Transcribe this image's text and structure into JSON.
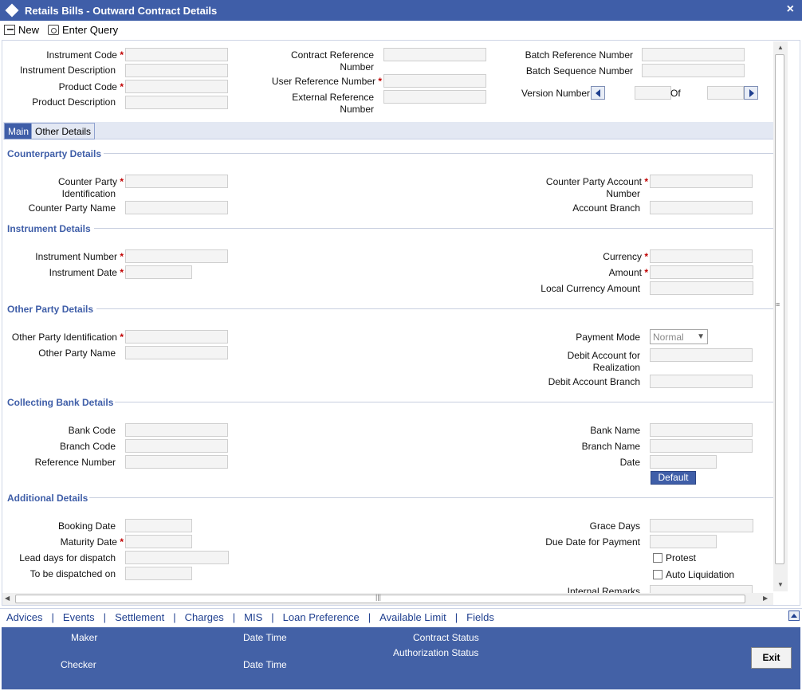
{
  "window": {
    "title": "Retails Bills - Outward Contract Details",
    "close_label": "×"
  },
  "toolbar": {
    "new_label": "New",
    "enter_query_label": "Enter Query"
  },
  "header": {
    "instrument_code": "Instrument Code",
    "instrument_description": "Instrument Description",
    "product_code": "Product Code",
    "product_description": "Product Description",
    "contract_reference_number_line1": "Contract Reference",
    "contract_reference_number_line2": "Number",
    "user_reference_number": "User Reference Number",
    "external_reference_line1": "External Reference",
    "external_reference_line2": "Number",
    "batch_reference_number": "Batch Reference Number",
    "batch_sequence_number": "Batch Sequence Number",
    "version_number": "Version Number",
    "of": "Of",
    "required_mark": "*"
  },
  "tabs": [
    {
      "label": "Main"
    },
    {
      "label": "Other Details"
    }
  ],
  "sections": {
    "counterparty": {
      "title": "Counterparty Details",
      "id_line1": "Counter Party",
      "id_line2": "Identification",
      "name": "Counter Party Name",
      "account_line1": "Counter Party Account",
      "account_line2": "Number",
      "account_branch": "Account Branch"
    },
    "instrument": {
      "title": "Instrument Details",
      "number": "Instrument Number",
      "date": "Instrument Date",
      "currency": "Currency",
      "amount": "Amount",
      "local_currency_amount": "Local Currency Amount"
    },
    "other_party": {
      "title": "Other Party Details",
      "identification": "Other Party Identification",
      "name": "Other Party Name",
      "payment_mode": "Payment Mode",
      "payment_mode_value": "Normal",
      "debit_account_line1": "Debit Account for",
      "debit_account_line2": "Realization",
      "debit_account_branch": "Debit Account Branch"
    },
    "collecting_bank": {
      "title": "Collecting Bank Details",
      "bank_code": "Bank Code",
      "branch_code": "Branch Code",
      "reference_number": "Reference Number",
      "bank_name": "Bank Name",
      "branch_name": "Branch Name",
      "date": "Date",
      "default_button": "Default"
    },
    "additional": {
      "title": "Additional Details",
      "booking_date": "Booking Date",
      "maturity_date": "Maturity Date",
      "lead_days": "Lead days for dispatch",
      "to_be_dispatched_on": "To be dispatched on",
      "grace_days": "Grace Days",
      "due_date_for_payment": "Due Date for Payment",
      "protest": "Protest",
      "auto_liquidation": "Auto Liquidation",
      "internal_remarks": "Internal Remarks"
    }
  },
  "links": [
    "Advices",
    "Events",
    "Settlement",
    "Charges",
    "MIS",
    "Loan Preference",
    "Available Limit",
    "Fields"
  ],
  "link_separator": "|",
  "footer": {
    "maker": "Maker",
    "checker": "Checker",
    "date_time": "Date Time",
    "contract_status": "Contract Status",
    "authorization_status": "Authorization Status",
    "exit": "Exit"
  },
  "colors": {
    "title_bar": "#3f5ea8",
    "section_heading": "#3f5ea8",
    "required": "#c00000",
    "footer": "#4361a6"
  }
}
